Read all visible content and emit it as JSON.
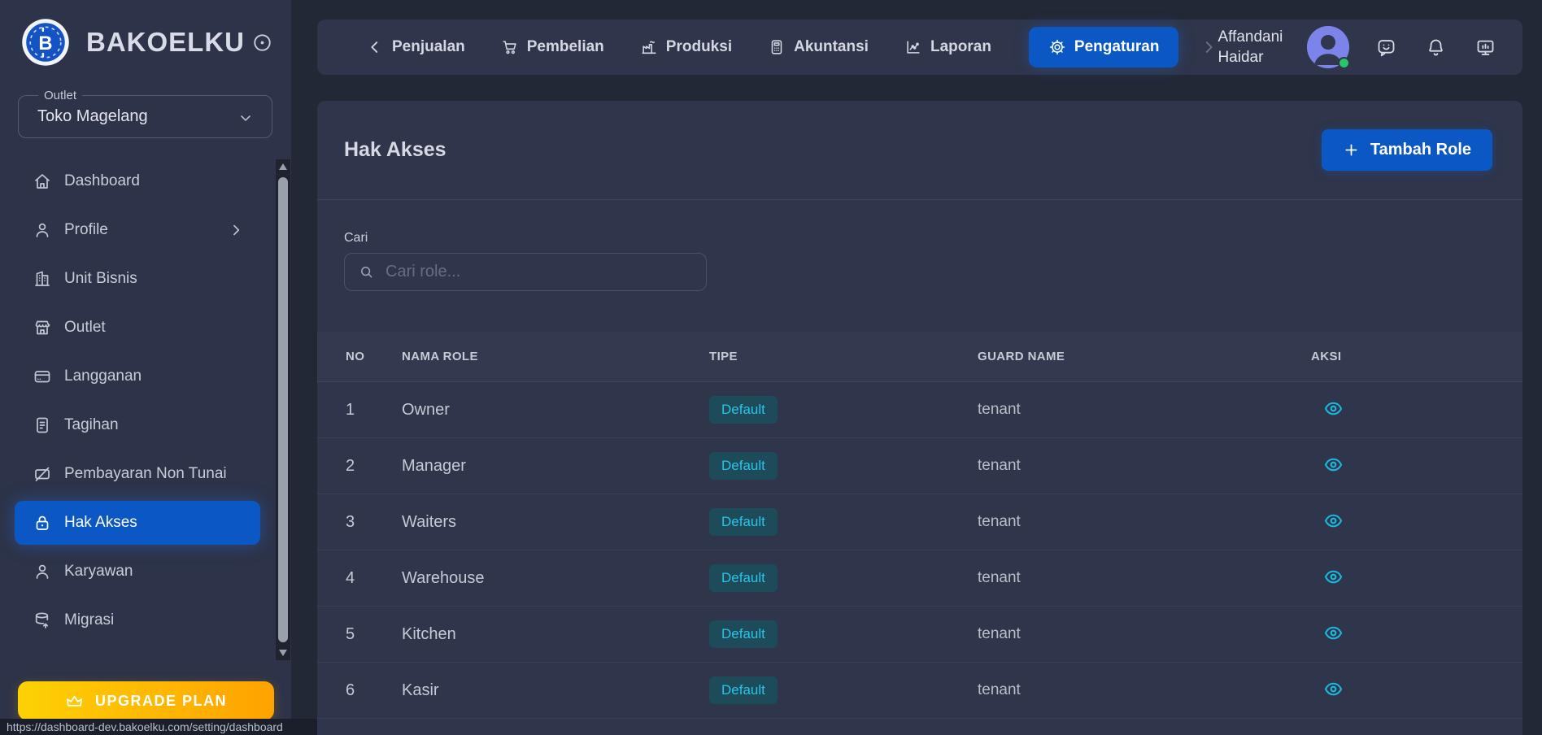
{
  "app": {
    "name": "BAKOELKU",
    "status_url": "https://dashboard-dev.bakoelku.com/setting/dashboard"
  },
  "sidebar": {
    "outlet_label": "Outlet",
    "outlet_value": "Toko Magelang",
    "items": [
      {
        "label": "Dashboard",
        "icon": "home-icon"
      },
      {
        "label": "Profile",
        "icon": "user-icon",
        "has_submenu": true
      },
      {
        "label": "Unit Bisnis",
        "icon": "building-icon"
      },
      {
        "label": "Outlet",
        "icon": "store-icon"
      },
      {
        "label": "Langganan",
        "icon": "credit-card-icon"
      },
      {
        "label": "Tagihan",
        "icon": "invoice-icon"
      },
      {
        "label": "Pembayaran Non Tunai",
        "icon": "cashless-icon"
      },
      {
        "label": "Hak Akses",
        "icon": "lock-icon",
        "active": true
      },
      {
        "label": "Karyawan",
        "icon": "user-icon"
      },
      {
        "label": "Migrasi",
        "icon": "database-icon"
      }
    ],
    "upgrade_label": "UPGRADE PLAN"
  },
  "topnav": {
    "items": [
      {
        "label": "Penjualan",
        "icon": "chevron-left-icon"
      },
      {
        "label": "Pembelian",
        "icon": "cart-icon"
      },
      {
        "label": "Produksi",
        "icon": "factory-icon"
      },
      {
        "label": "Akuntansi",
        "icon": "calculator-icon"
      },
      {
        "label": "Laporan",
        "icon": "chart-icon"
      },
      {
        "label": "Pengaturan",
        "icon": "gear-icon",
        "active": true
      }
    ],
    "user_name_line1": "Affandani",
    "user_name_line2": "Haidar"
  },
  "main": {
    "title": "Hak Akses",
    "add_button_label": "Tambah Role",
    "search_label": "Cari",
    "search_placeholder": "Cari role...",
    "table": {
      "columns": [
        "NO",
        "NAMA ROLE",
        "TIPE",
        "GUARD NAME",
        "AKSI"
      ],
      "rows": [
        {
          "no": "1",
          "name": "Owner",
          "tipe": "Default",
          "guard": "tenant"
        },
        {
          "no": "2",
          "name": "Manager",
          "tipe": "Default",
          "guard": "tenant"
        },
        {
          "no": "3",
          "name": "Waiters",
          "tipe": "Default",
          "guard": "tenant"
        },
        {
          "no": "4",
          "name": "Warehouse",
          "tipe": "Default",
          "guard": "tenant"
        },
        {
          "no": "5",
          "name": "Kitchen",
          "tipe": "Default",
          "guard": "tenant"
        },
        {
          "no": "6",
          "name": "Kasir",
          "tipe": "Default",
          "guard": "tenant"
        }
      ]
    }
  },
  "colors": {
    "accent_blue": "#0b57c4",
    "badge_bg": "#1d4b59",
    "badge_text": "#2bc4e9",
    "eye_icon": "#1ab8dd",
    "upgrade_gradient_from": "#fdd104",
    "upgrade_gradient_to": "#ffa201",
    "online_dot": "#27c46a"
  }
}
